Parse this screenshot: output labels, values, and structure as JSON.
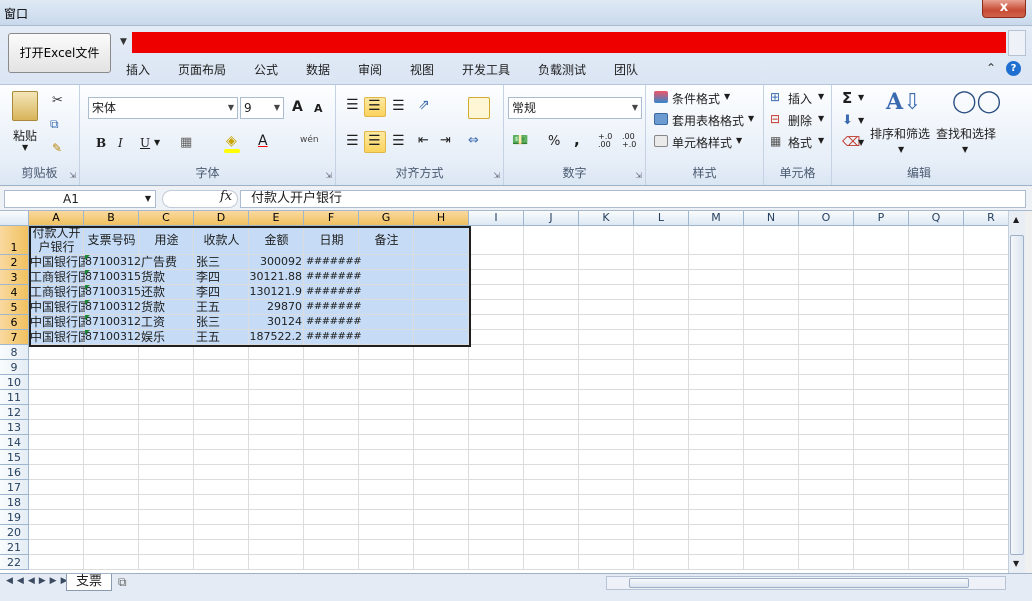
{
  "window": {
    "title": "窗口",
    "close_label": "x"
  },
  "toolbar": {
    "open_excel_label": "打开Excel文件"
  },
  "tabs": [
    "插入",
    "页面布局",
    "公式",
    "数据",
    "审阅",
    "视图",
    "开发工具",
    "负载测试",
    "团队"
  ],
  "ribbon": {
    "clipboard": {
      "label": "剪贴板",
      "paste": "粘贴"
    },
    "font": {
      "label": "字体",
      "font_name": "宋体",
      "font_size": "9",
      "bold": "B",
      "italic": "I",
      "underline": "U",
      "grow": "A",
      "shrink": "A",
      "wen": "wén"
    },
    "alignment": {
      "label": "对齐方式"
    },
    "number": {
      "label": "数字",
      "format": "常规",
      "percent": "%",
      "comma": ",",
      "inc_decimal": "+.0 .00",
      "dec_decimal": ".00 +.0"
    },
    "styles": {
      "label": "样式",
      "conditional": "条件格式",
      "table_format": "套用表格格式",
      "cell_styles": "单元格样式"
    },
    "cells": {
      "label": "单元格",
      "insert": "插入",
      "delete": "删除",
      "format": "格式"
    },
    "editing": {
      "label": "编辑",
      "sigma": "Σ",
      "sort_filter": "排序和筛选",
      "find_select": "查找和选择"
    }
  },
  "formula_bar": {
    "name_box": "A1",
    "fx": "fx",
    "content": "付款人开户银行"
  },
  "columns": [
    "A",
    "B",
    "C",
    "D",
    "E",
    "F",
    "G",
    "H",
    "I",
    "J",
    "K",
    "L",
    "M",
    "N",
    "O",
    "P",
    "Q",
    "R"
  ],
  "rows": [
    "1",
    "2",
    "3",
    "4",
    "5",
    "6",
    "7",
    "8",
    "9",
    "10",
    "11",
    "12",
    "13",
    "14",
    "15",
    "16",
    "17",
    "18",
    "19",
    "20",
    "21",
    "22"
  ],
  "header_row": {
    "a1_line1": "付款人开",
    "a1_line2": "户银行",
    "b": "支票号码",
    "c": "用途",
    "d": "收款人",
    "e": "金额",
    "f": "日期",
    "g": "备注"
  },
  "table_rows": [
    {
      "a": "中国银行国",
      "b": "87100312",
      "c": "广告费",
      "d": "张三",
      "e": "300092",
      "f": "########"
    },
    {
      "a": "工商银行国",
      "b": "87100315",
      "c": "货款",
      "d": "李四",
      "e": "30121.88",
      "f": "########"
    },
    {
      "a": "工商银行国",
      "b": "87100315",
      "c": "还款",
      "d": "李四",
      "e": "130121.9",
      "f": "########"
    },
    {
      "a": "中国银行国",
      "b": "87100312",
      "c": "货款",
      "d": "王五",
      "e": "29870",
      "f": "########"
    },
    {
      "a": "中国银行国",
      "b": "87100312",
      "c": "工资",
      "d": "张三",
      "e": "30124",
      "f": "########"
    },
    {
      "a": "中国银行国",
      "b": "87100312",
      "c": "娱乐",
      "d": "王五",
      "e": "187522.2",
      "f": "########"
    }
  ],
  "sheet": {
    "tab_name": "支票"
  }
}
